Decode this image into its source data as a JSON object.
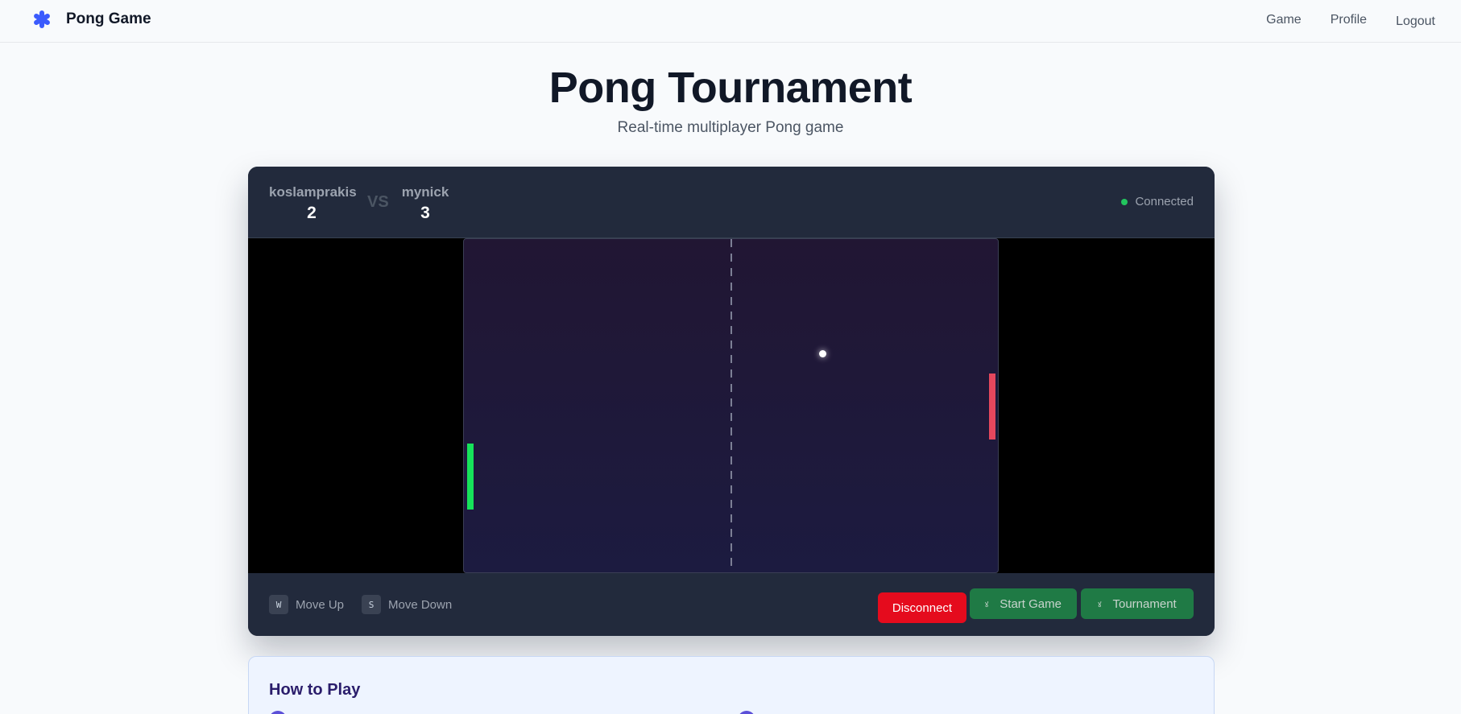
{
  "nav": {
    "brand": "Pong Game",
    "links": [
      "Game",
      "Profile",
      "Logout"
    ],
    "accent": "#3b5bfd"
  },
  "hero": {
    "title": "Pong Tournament",
    "subtitle": "Real-time multiplayer Pong game"
  },
  "match": {
    "player1": {
      "name": "koslamprakis",
      "score": "2"
    },
    "vs": "VS",
    "player2": {
      "name": "mynick",
      "score": "3"
    },
    "status": "Connected",
    "status_color": "#22c55e"
  },
  "game": {
    "left_paddle_color": "#16e35a",
    "right_paddle_color": "#e5475d"
  },
  "controls": [
    {
      "key": "W",
      "label": "Move Up"
    },
    {
      "key": "S",
      "label": "Move Down"
    }
  ],
  "actions": {
    "disconnect": "Disconnect",
    "start_game": "Start Game",
    "tournament": "Tournament",
    "icon": "ꙋ"
  },
  "how_to_play": {
    "title": "How to Play"
  }
}
